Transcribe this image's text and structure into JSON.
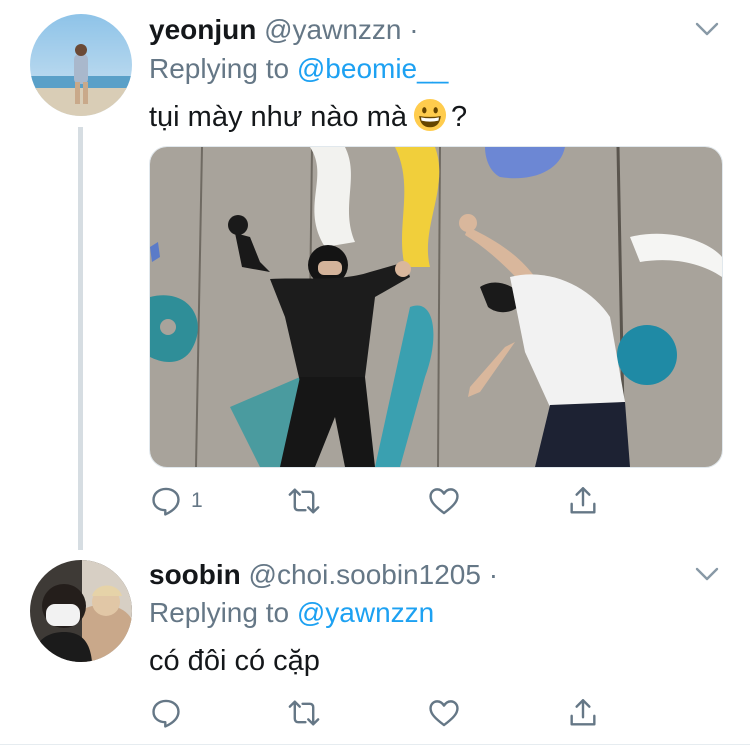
{
  "tweets": [
    {
      "name": "yeonjun",
      "handle": "@yawnzzn",
      "dot": "·",
      "replying_prefix": "Replying to ",
      "replying_to": "@beomie__",
      "text_before_emoji": "tụi mày như nào mà",
      "emoji": "grinning-face",
      "text_after_emoji": "?",
      "has_media": true,
      "reply_count": "1"
    },
    {
      "name": "soobin",
      "handle": "@choi.soobin1205",
      "dot": "·",
      "replying_prefix": "Replying to ",
      "replying_to": "@yawnzzn",
      "text": "có đôi có cặp",
      "has_media": false,
      "reply_count": ""
    }
  ],
  "colors": {
    "name": "#14171a",
    "secondary": "#657786",
    "link": "#1da1f2",
    "thread_line": "#d6dde2"
  },
  "icons": [
    "reply-icon",
    "retweet-icon",
    "like-icon",
    "share-icon",
    "chevron-down-icon"
  ]
}
